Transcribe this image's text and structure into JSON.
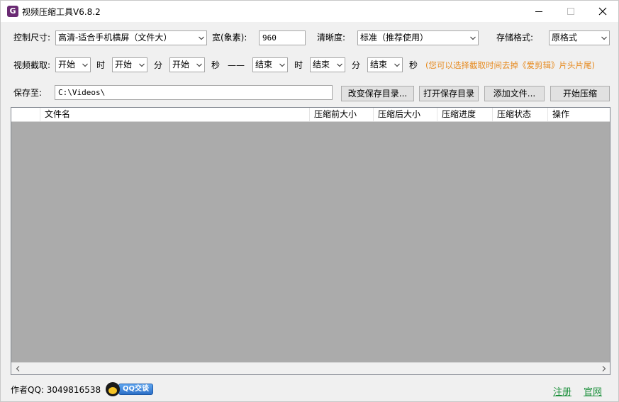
{
  "window": {
    "title": "视频压缩工具V6.8.2",
    "icon_glyph": "G",
    "controls": [
      "minimize-icon",
      "maximize-icon",
      "close-icon"
    ]
  },
  "size_row": {
    "size_label": "控制尺寸:",
    "size_value": "高清-适合手机横屏（文件大）",
    "width_label": "宽(象素):",
    "width_value": "960",
    "clarity_label": "清晰度:",
    "clarity_value": "标准（推荐使用）",
    "format_label": "存储格式:",
    "format_value": "原格式"
  },
  "trim_row": {
    "label": "视频截取:",
    "start_hour": "开始",
    "hour_unit": "时",
    "start_min": "开始",
    "min_unit": "分",
    "start_sec": "开始",
    "sec_unit": "秒",
    "separator": "——",
    "end_hour": "结束",
    "end_hour_unit": "时",
    "end_min": "结束",
    "end_min_unit": "分",
    "end_sec": "结束",
    "end_sec_unit": "秒",
    "hint": "(您可以选择截取时间去掉《爱剪辑》片头片尾)",
    "hint_color": "#e68a1f"
  },
  "save_row": {
    "label": "保存至:",
    "path": "C:\\Videos\\",
    "change_dir_button": "改变保存目录...",
    "open_dir_button": "打开保存目录",
    "add_file_button": "添加文件...",
    "start_button": "开始压缩"
  },
  "table": {
    "columns": [
      "",
      "文件名",
      "压缩前大小",
      "压缩后大小",
      "压缩进度",
      "压缩状态",
      "操作"
    ],
    "rows": []
  },
  "footer": {
    "author": "作者QQ: 3049816538",
    "qq_button": "QQ交谈",
    "register_link": "注册",
    "website_link": "官网",
    "link_color": "#1a8f3a"
  }
}
